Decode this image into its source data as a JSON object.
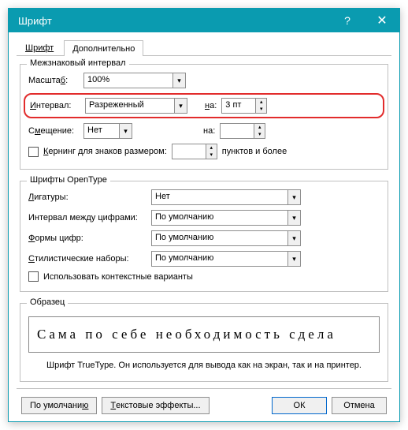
{
  "window": {
    "title": "Шрифт"
  },
  "tabs": {
    "font": "Шрифт",
    "advanced": "Дополнительно"
  },
  "spacing": {
    "group_title": "Межзнаковый интервал",
    "scale_label": "Масштаб:",
    "scale_value": "100%",
    "interval_label": "Интервал:",
    "interval_value": "Разреженный",
    "interval_at_label": "на:",
    "interval_at_value": "3 пт",
    "offset_label": "Смещение:",
    "offset_value": "Нет",
    "offset_at_label": "на:",
    "offset_at_value": "",
    "kerning_label": "Кернинг для знаков размером:",
    "kerning_value": "",
    "kerning_suffix": "пунктов и более"
  },
  "opentype": {
    "group_title": "Шрифты OpenType",
    "ligatures_label": "Лигатуры:",
    "ligatures_value": "Нет",
    "num_spacing_label": "Интервал между цифрами:",
    "num_spacing_value": "По умолчанию",
    "num_forms_label": "Формы цифр:",
    "num_forms_value": "По умолчанию",
    "stylistic_label": "Стилистические наборы:",
    "stylistic_value": "По умолчанию",
    "contextual_label": "Использовать контекстные варианты"
  },
  "sample": {
    "group_title": "Образец",
    "text": "Сама по себе необходимость сдела",
    "description": "Шрифт TrueType. Он используется для вывода как на экран, так и на принтер."
  },
  "buttons": {
    "default": "По умолчанию",
    "effects": "Текстовые эффекты...",
    "ok": "ОК",
    "cancel": "Отмена"
  }
}
